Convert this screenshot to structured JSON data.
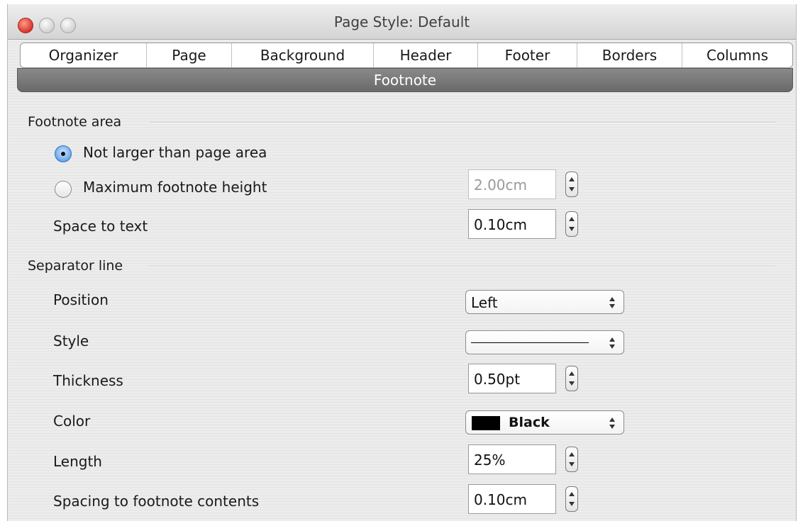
{
  "window": {
    "title": "Page Style: Default",
    "controls": [
      "close",
      "minimize",
      "zoom"
    ]
  },
  "tabs": [
    {
      "label": "Organizer"
    },
    {
      "label": "Page"
    },
    {
      "label": "Background"
    },
    {
      "label": "Header"
    },
    {
      "label": "Footer"
    },
    {
      "label": "Borders"
    },
    {
      "label": "Columns"
    }
  ],
  "selected_tab": {
    "label": "Footnote"
  },
  "footnote_area": {
    "heading": "Footnote area",
    "option_not_larger": {
      "label": "Not larger than page area",
      "checked": true
    },
    "option_max_height": {
      "label": "Maximum footnote height",
      "checked": false,
      "value": "2.00cm"
    },
    "space_to_text": {
      "label": "Space to text",
      "value": "0.10cm"
    }
  },
  "separator_line": {
    "heading": "Separator line",
    "position": {
      "label": "Position",
      "value": "Left"
    },
    "style": {
      "label": "Style",
      "value": "solid line"
    },
    "thickness": {
      "label": "Thickness",
      "value": "0.50pt"
    },
    "color": {
      "label": "Color",
      "value": "Black",
      "swatch": "#000000"
    },
    "length": {
      "label": "Length",
      "value": "25%"
    },
    "spacing": {
      "label": "Spacing to footnote contents",
      "value": "0.10cm"
    }
  },
  "colors": {
    "close_button": "#e0443a",
    "radio_selected": "#5b9de8",
    "selected_tab_bg": "#7a7a7a"
  }
}
